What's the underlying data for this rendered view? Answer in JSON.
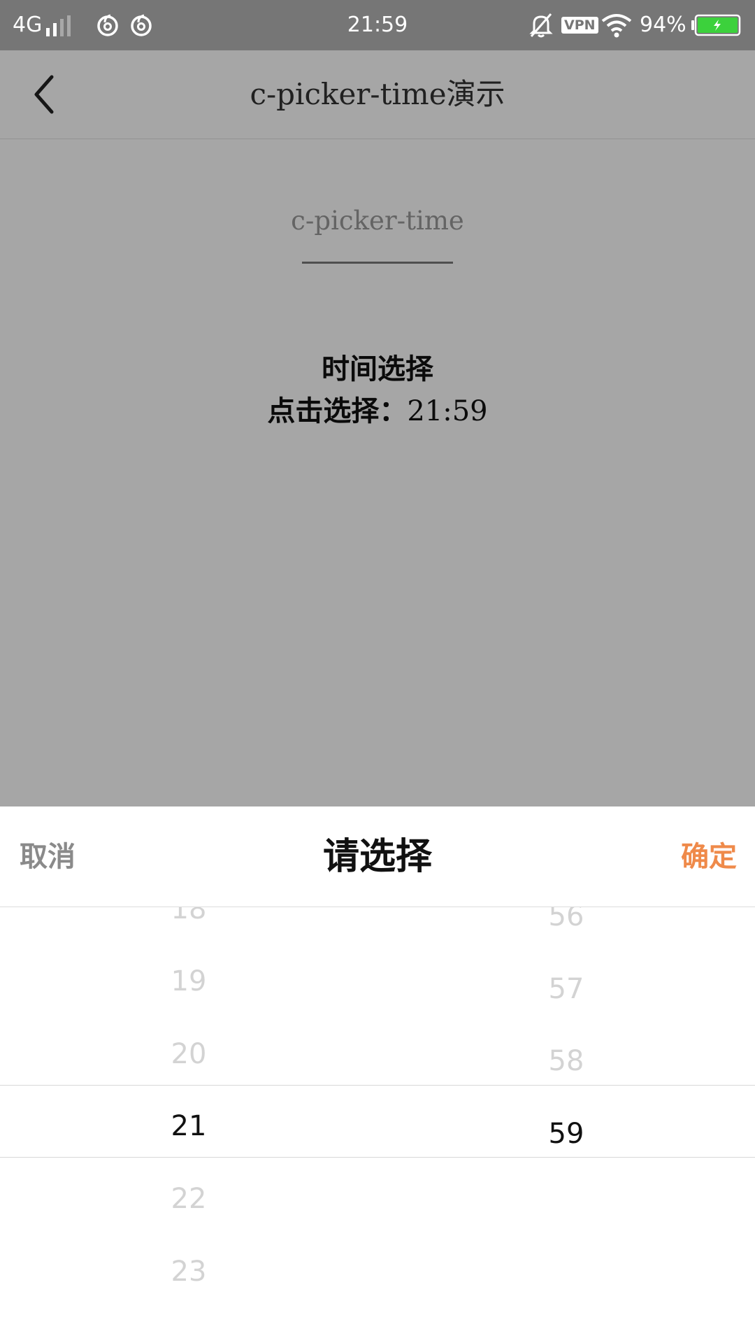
{
  "status_bar": {
    "network": "4G",
    "time": "21:59",
    "vpn": "VPN",
    "battery": "94%"
  },
  "nav": {
    "title": "c-picker-time演示"
  },
  "content": {
    "section_title": "c-picker-time",
    "demo_label": "时间选择",
    "value_label": "点击选择：",
    "value": "21:59"
  },
  "picker": {
    "cancel": "取消",
    "title": "请选择",
    "confirm": "确定",
    "hours": [
      "18",
      "19",
      "20",
      "21",
      "22",
      "23"
    ],
    "minutes": [
      "56",
      "57",
      "58",
      "59"
    ],
    "selected_hour": "21",
    "selected_minute": "59",
    "confirm_color": "#ef8a4a"
  }
}
